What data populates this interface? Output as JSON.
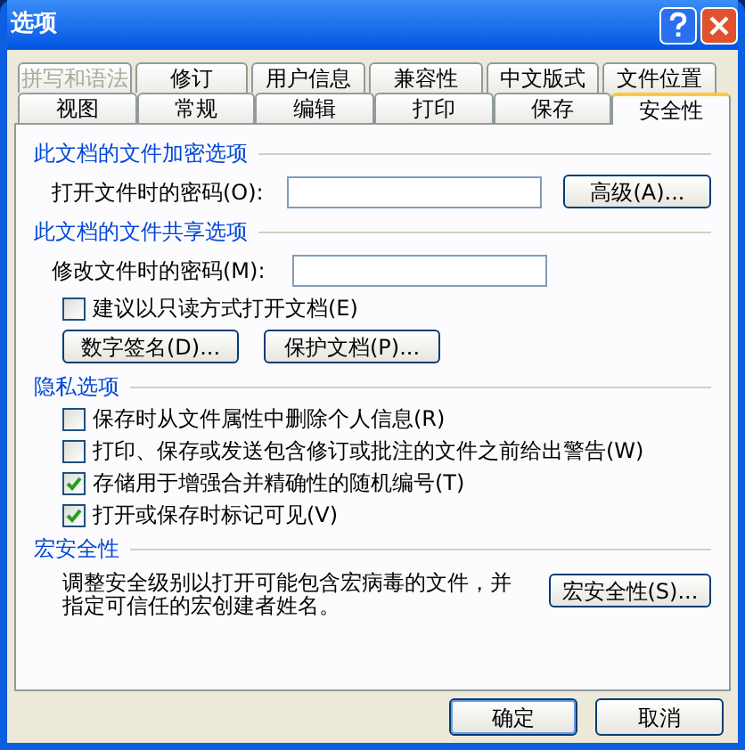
{
  "window": {
    "title": "选项"
  },
  "tab_rows": [
    {
      "tabs": [
        {
          "label": "拼写和语法",
          "selected": false,
          "disabled": true
        },
        {
          "label": "修订",
          "selected": false,
          "disabled": false
        },
        {
          "label": "用户信息",
          "selected": false,
          "disabled": false
        },
        {
          "label": "兼容性",
          "selected": false,
          "disabled": false
        },
        {
          "label": "中文版式",
          "selected": false,
          "disabled": false
        },
        {
          "label": "文件位置",
          "selected": false,
          "disabled": false
        }
      ]
    },
    {
      "tabs": [
        {
          "label": "视图",
          "selected": false,
          "disabled": false
        },
        {
          "label": "常规",
          "selected": false,
          "disabled": false
        },
        {
          "label": "编辑",
          "selected": false,
          "disabled": false
        },
        {
          "label": "打印",
          "selected": false,
          "disabled": false
        },
        {
          "label": "保存",
          "selected": false,
          "disabled": false
        },
        {
          "label": "安全性",
          "selected": true,
          "disabled": false
        }
      ]
    }
  ],
  "sections": [
    {
      "title": "此文档的文件加密选项",
      "items": [
        {
          "kind": "field",
          "label": "打开文件时的密码(O):",
          "button": "高级(A)..."
        }
      ]
    },
    {
      "title": "此文档的文件共享选项",
      "items": [
        {
          "kind": "field",
          "label": "修改文件时的密码(M):"
        },
        {
          "kind": "checkbox",
          "label": "建议以只读方式打开文档(E)",
          "checked": false
        },
        {
          "kind": "buttons",
          "buttons": [
            "数字签名(D)...",
            "保护文档(P)..."
          ]
        }
      ]
    },
    {
      "title": "隐私选项",
      "items": [
        {
          "kind": "checkbox",
          "label": "保存时从文件属性中删除个人信息(R)",
          "checked": false
        },
        {
          "kind": "checkbox",
          "label": "打印、保存或发送包含修订或批注的文件之前给出警告(W)",
          "checked": false
        },
        {
          "kind": "checkbox",
          "label": "存储用于增强合并精确性的随机编号(T)",
          "checked": true
        },
        {
          "kind": "checkbox",
          "label": "打开或保存时标记可见(V)",
          "checked": true
        }
      ]
    },
    {
      "title": "宏安全性",
      "items": [
        {
          "kind": "note",
          "text": "调整安全级别以打开可能包含宏病毒的文件，并指定可信任的宏创建者姓名。",
          "button": "宏安全性(S)..."
        }
      ]
    }
  ],
  "buttons": [
    {
      "label": "确定",
      "default": true
    },
    {
      "label": "取消",
      "default": false
    }
  ]
}
